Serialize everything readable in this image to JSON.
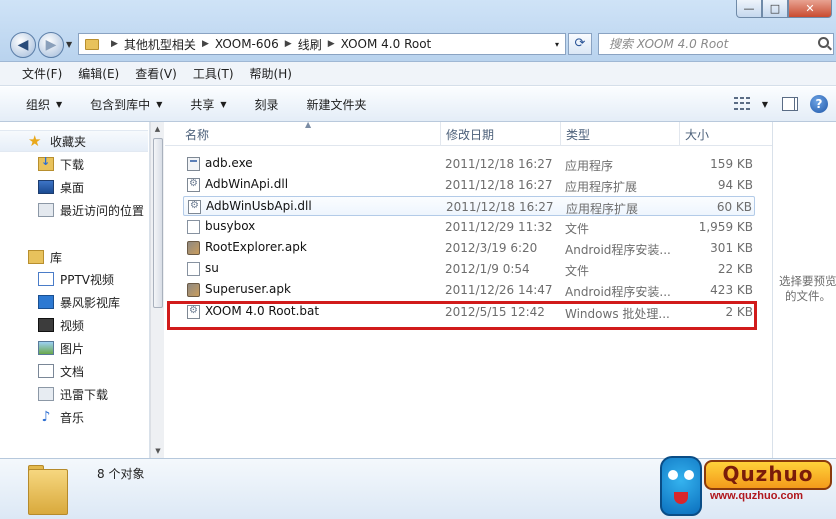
{
  "window": {
    "buttons": [
      "—",
      "□",
      "✕"
    ]
  },
  "nav": {
    "back_icon": "back-arrow-icon",
    "forward_icon": "forward-arrow-icon"
  },
  "address": {
    "segments": [
      "其他机型相关",
      "XOOM-606",
      "线刷",
      "XOOM 4.0 Root"
    ],
    "separator": "▶",
    "dropdown": "▾"
  },
  "search": {
    "placeholder": "搜索 XOOM 4.0 Root"
  },
  "menubar": {
    "items": [
      "文件(F)",
      "编辑(E)",
      "查看(V)",
      "工具(T)",
      "帮助(H)"
    ]
  },
  "toolbar": {
    "organize": "组织",
    "include_library": "包含到库中",
    "share": "共享",
    "burn": "刻录",
    "new_folder": "新建文件夹",
    "help": "?"
  },
  "sidebar": {
    "favorites_label": "收藏夹",
    "favorites": [
      "下载",
      "桌面",
      "最近访问的位置"
    ],
    "libraries_label": "库",
    "libraries": [
      "PPTV视频",
      "暴风影视库",
      "视频",
      "图片",
      "文档",
      "迅雷下载",
      "音乐"
    ]
  },
  "columns": {
    "name": "名称",
    "date": "修改日期",
    "type": "类型",
    "size": "大小"
  },
  "files": [
    {
      "name": "adb.exe",
      "date": "2011/12/18 16:27",
      "type": "应用程序",
      "size": "159 KB",
      "icon": "exe-file-icon"
    },
    {
      "name": "AdbWinApi.dll",
      "date": "2011/12/18 16:27",
      "type": "应用程序扩展",
      "size": "94 KB",
      "icon": "dll-file-icon"
    },
    {
      "name": "AdbWinUsbApi.dll",
      "date": "2011/12/18 16:27",
      "type": "应用程序扩展",
      "size": "60 KB",
      "icon": "dll-file-icon"
    },
    {
      "name": "busybox",
      "date": "2011/12/29 11:32",
      "type": "文件",
      "size": "1,959 KB",
      "icon": "blank-file-icon"
    },
    {
      "name": "RootExplorer.apk",
      "date": "2012/3/19 6:20",
      "type": "Android程序安装...",
      "size": "301 KB",
      "icon": "apk-file-icon"
    },
    {
      "name": "su",
      "date": "2012/1/9 0:54",
      "type": "文件",
      "size": "22 KB",
      "icon": "blank-file-icon"
    },
    {
      "name": "Superuser.apk",
      "date": "2011/12/26 14:47",
      "type": "Android程序安装...",
      "size": "423 KB",
      "icon": "apk-file-icon"
    },
    {
      "name": "XOOM 4.0 Root.bat",
      "date": "2012/5/15 12:42",
      "type": "Windows 批处理...",
      "size": "2 KB",
      "icon": "bat-file-icon"
    }
  ],
  "preview": {
    "line1": "选择要预览",
    "line2": "的文件。"
  },
  "details": {
    "count": "8 个对象"
  },
  "watermark": {
    "logo": "Quzhuo",
    "url": "www.quzhuo.com"
  },
  "colors": {
    "highlight": "#d11b1b",
    "accent": "#2b5597"
  }
}
